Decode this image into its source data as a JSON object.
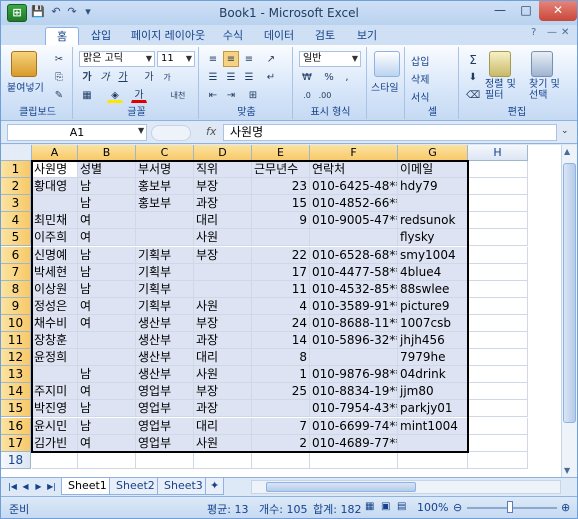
{
  "title": "Book1 - Microsoft Excel",
  "office_button": "⊞",
  "quick_access": {
    "save": "💾",
    "undo": "↶",
    "redo": "↷",
    "more": "▾"
  },
  "window_buttons": {
    "min": "—",
    "max": "□",
    "close": "✕"
  },
  "tabs": [
    "홈",
    "삽입",
    "페이지 레이아웃",
    "수식",
    "데이터",
    "검토",
    "보기"
  ],
  "ribbon": {
    "clipboard": {
      "label": "클립보드",
      "paste": "붙여넣기"
    },
    "font": {
      "label": "글꼴",
      "name": "맑은 고딕",
      "size": "11",
      "bold": "가",
      "italic": "가",
      "underline": "가",
      "grow": "가",
      "shrink": "가",
      "korean": "내천"
    },
    "align": {
      "label": "맞춤"
    },
    "number": {
      "label": "표시 형식",
      "format": "일반",
      "percent": "%",
      "comma": ","
    },
    "styles": {
      "label": "스타일"
    },
    "cells": {
      "label": "셀",
      "insert": "삽입",
      "delete": "삭제",
      "format": "서식"
    },
    "edit": {
      "label": "편집",
      "sort": "정렬 및 필터",
      "find": "찾기 및 선택",
      "sigma": "Σ"
    }
  },
  "formula_bar": {
    "name_box": "A1",
    "fx": "fx",
    "value": "사원명"
  },
  "columns": [
    "A",
    "B",
    "C",
    "D",
    "E",
    "F",
    "G",
    "H"
  ],
  "rows": [
    "1",
    "2",
    "3",
    "4",
    "5",
    "6",
    "7",
    "8",
    "9",
    "10",
    "11",
    "12",
    "13",
    "14",
    "15",
    "16",
    "17",
    "18"
  ],
  "cells": [
    [
      "사원명",
      "성별",
      "부서명",
      "직위",
      "근무년수",
      "연락처",
      "이메일"
    ],
    [
      "황대영",
      "남",
      "홍보부",
      "부장",
      "23",
      "010-6425-48**",
      "hdy79"
    ],
    [
      "",
      "남",
      "홍보부",
      "과장",
      "15",
      "010-4852-66**",
      ""
    ],
    [
      "최민채",
      "여",
      "",
      "대리",
      "9",
      "010-9005-47**",
      "redsunok"
    ],
    [
      "이주희",
      "여",
      "",
      "사원",
      "",
      "",
      "flysky"
    ],
    [
      "신명예",
      "남",
      "기획부",
      "부장",
      "22",
      "010-6528-68**",
      "smy1004"
    ],
    [
      "박세현",
      "남",
      "기획부",
      "",
      "17",
      "010-4477-58**",
      "4blue4"
    ],
    [
      "이상원",
      "남",
      "기획부",
      "",
      "11",
      "010-4532-85**",
      "88swlee"
    ],
    [
      "정성은",
      "여",
      "기획부",
      "사원",
      "4",
      "010-3589-91**",
      "picture9"
    ],
    [
      "채수비",
      "여",
      "생산부",
      "부장",
      "24",
      "010-8688-11**",
      "1007csb"
    ],
    [
      "장창훈",
      "",
      "생산부",
      "과장",
      "14",
      "010-5896-32**",
      "jhjh456"
    ],
    [
      "윤정희",
      "",
      "생산부",
      "대리",
      "8",
      "",
      "7979he"
    ],
    [
      "",
      "남",
      "생산부",
      "사원",
      "1",
      "010-9876-98**",
      "04drink"
    ],
    [
      "주지미",
      "여",
      "영업부",
      "부장",
      "25",
      "010-8834-19**",
      "jjm80"
    ],
    [
      "박진영",
      "남",
      "영업부",
      "과장",
      "",
      "010-7954-43**",
      "parkjy01"
    ],
    [
      "윤시민",
      "남",
      "영업부",
      "대리",
      "7",
      "010-6699-74**",
      "mint1004"
    ],
    [
      "김가빈",
      "여",
      "영업부",
      "사원",
      "2",
      "010-4689-77**",
      ""
    ]
  ],
  "sheets": [
    "Sheet1",
    "Sheet2",
    "Sheet3"
  ],
  "status": {
    "ready": "준비",
    "average": "평균: 13",
    "count": "개수: 105",
    "sum": "합계: 182",
    "zoom": "100%",
    "zoom_level": 100
  }
}
